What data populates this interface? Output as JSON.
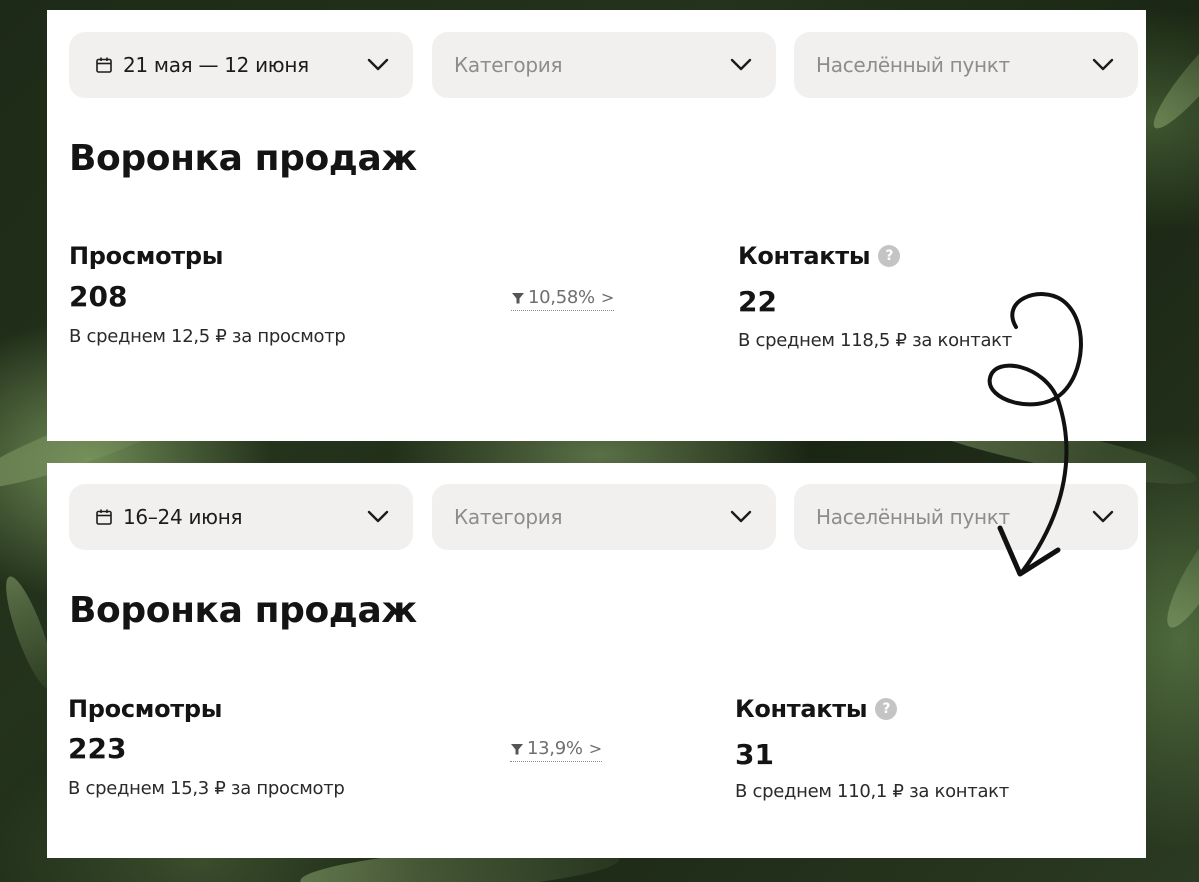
{
  "panels": [
    {
      "filters": {
        "date": "21 мая — 12 июня",
        "category_placeholder": "Категория",
        "city_placeholder": "Населённый пункт"
      },
      "title": "Воронка продаж",
      "views": {
        "label": "Просмотры",
        "value": "208",
        "note": "В среднем 12,5 ₽ за просмотр"
      },
      "conversion": "10,58%",
      "contacts": {
        "label": "Контакты",
        "value": "22",
        "note": "В среднем 118,5 ₽ за контакт"
      }
    },
    {
      "filters": {
        "date": "16–24 июня",
        "category_placeholder": "Категория",
        "city_placeholder": "Населённый пункт"
      },
      "title": "Воронка продаж",
      "views": {
        "label": "Просмотры",
        "value": "223",
        "note": "В среднем 15,3 ₽ за просмотр"
      },
      "conversion": "13,9%",
      "contacts": {
        "label": "Контакты",
        "value": "31",
        "note": "В среднем 110,1 ₽ за контакт"
      }
    }
  ],
  "icons": {
    "calendar": "calendar-icon",
    "chevron": "chevron-down-icon",
    "help": "help-icon",
    "funnel": "funnel-icon",
    "arrow": "chevron-right-icon"
  },
  "colors": {
    "panel_bg": "#ffffff",
    "filter_bg": "#f1f0ef",
    "text": "#141414",
    "muted": "#8d8d8d",
    "help_badge": "#c4c4c4"
  }
}
